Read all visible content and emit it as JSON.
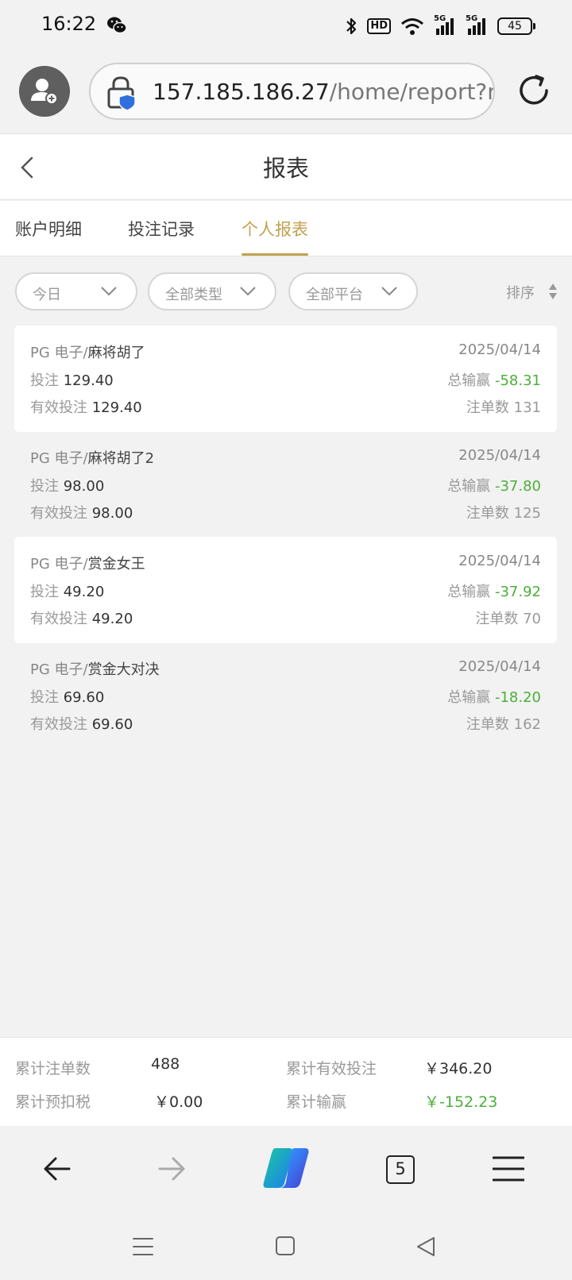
{
  "status_bar": {
    "time": "16:22",
    "hd_label": "HD",
    "network_1": "5G",
    "network_2": "5G",
    "battery": "45"
  },
  "browser": {
    "url_host": "157.185.186.27",
    "url_path": "/home/report?rep",
    "tab_count": "5"
  },
  "header": {
    "title": "报表"
  },
  "tabs": [
    {
      "label": "账户明细"
    },
    {
      "label": "投注记录"
    },
    {
      "label": "个人报表"
    }
  ],
  "filters": {
    "date": "今日",
    "type": "全部类型",
    "platform": "全部平台",
    "sort_label": "排序"
  },
  "labels": {
    "bet": "投注",
    "valid_bet": "有效投注",
    "total_win": "总输赢",
    "order_count": "注单数"
  },
  "rows": [
    {
      "platform": "PG 电子/",
      "game": "麻将胡了",
      "date": "2025/04/14",
      "bet": "129.40",
      "valid_bet": "129.40",
      "total_win": "-58.31",
      "order_count": "131"
    },
    {
      "platform": "PG 电子/",
      "game": "麻将胡了2",
      "date": "2025/04/14",
      "bet": "98.00",
      "valid_bet": "98.00",
      "total_win": "-37.80",
      "order_count": "125"
    },
    {
      "platform": "PG 电子/",
      "game": "赏金女王",
      "date": "2025/04/14",
      "bet": "49.20",
      "valid_bet": "49.20",
      "total_win": "-37.92",
      "order_count": "70"
    },
    {
      "platform": "PG 电子/",
      "game": "赏金大对决",
      "date": "2025/04/14",
      "bet": "69.60",
      "valid_bet": "69.60",
      "total_win": "-18.20",
      "order_count": "162"
    }
  ],
  "summary": {
    "total_orders_label": "累计注单数",
    "total_orders_value": "488",
    "total_valid_label": "累计有效投注",
    "total_valid_value": "￥346.20",
    "total_tax_label": "累计预扣税",
    "total_tax_value": "￥0.00",
    "total_win_label": "累计输赢",
    "total_win_value": "￥-152.23"
  },
  "colors": {
    "accent": "#c2a152",
    "win_green": "#4caf3a"
  }
}
